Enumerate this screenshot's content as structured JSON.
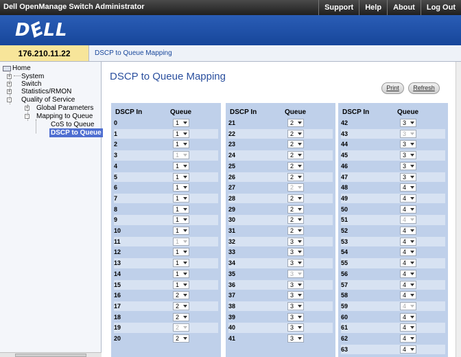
{
  "app_title": "Dell OpenManage Switch Administrator",
  "top_links": [
    "Support",
    "Help",
    "About",
    "Log Out"
  ],
  "logo": "D&LL",
  "ip": "176.210.11.22",
  "breadcrumb": "DSCP to Queue Mapping",
  "tree": [
    {
      "label": "Home",
      "icon": "home-icon"
    },
    {
      "label": "System",
      "expander": "+"
    },
    {
      "label": "Switch",
      "expander": "+"
    },
    {
      "label": "Statistics/RMON",
      "expander": "+"
    },
    {
      "label": "Quality of Service",
      "expander": "-"
    },
    {
      "label": "Global Parameters",
      "expander": "+"
    },
    {
      "label": "Mapping to Queue",
      "expander": "-"
    },
    {
      "label": "CoS to Queue"
    },
    {
      "label": "DSCP to Queue",
      "selected": true
    }
  ],
  "page_title": "DSCP to Queue Mapping",
  "buttons": {
    "print": "Print",
    "refresh": "Refresh"
  },
  "columns": {
    "dscp": "DSCP In",
    "queue": "Queue"
  },
  "tables": [
    {
      "rows": [
        {
          "dscp": "0",
          "queue": "1"
        },
        {
          "dscp": "1",
          "queue": "1"
        },
        {
          "dscp": "2",
          "queue": "1"
        },
        {
          "dscp": "3",
          "queue": "1",
          "disabled": true
        },
        {
          "dscp": "4",
          "queue": "1"
        },
        {
          "dscp": "5",
          "queue": "1"
        },
        {
          "dscp": "6",
          "queue": "1"
        },
        {
          "dscp": "7",
          "queue": "1"
        },
        {
          "dscp": "8",
          "queue": "1"
        },
        {
          "dscp": "9",
          "queue": "1"
        },
        {
          "dscp": "10",
          "queue": "1"
        },
        {
          "dscp": "11",
          "queue": "1",
          "disabled": true
        },
        {
          "dscp": "12",
          "queue": "1"
        },
        {
          "dscp": "13",
          "queue": "1"
        },
        {
          "dscp": "14",
          "queue": "1"
        },
        {
          "dscp": "15",
          "queue": "1"
        },
        {
          "dscp": "16",
          "queue": "2"
        },
        {
          "dscp": "17",
          "queue": "2"
        },
        {
          "dscp": "18",
          "queue": "2"
        },
        {
          "dscp": "19",
          "queue": "2",
          "disabled": true
        },
        {
          "dscp": "20",
          "queue": "2"
        }
      ]
    },
    {
      "rows": [
        {
          "dscp": "21",
          "queue": "2"
        },
        {
          "dscp": "22",
          "queue": "2"
        },
        {
          "dscp": "23",
          "queue": "2"
        },
        {
          "dscp": "24",
          "queue": "2"
        },
        {
          "dscp": "25",
          "queue": "2"
        },
        {
          "dscp": "26",
          "queue": "2"
        },
        {
          "dscp": "27",
          "queue": "2",
          "disabled": true
        },
        {
          "dscp": "28",
          "queue": "2"
        },
        {
          "dscp": "29",
          "queue": "2"
        },
        {
          "dscp": "30",
          "queue": "2"
        },
        {
          "dscp": "31",
          "queue": "2"
        },
        {
          "dscp": "32",
          "queue": "3"
        },
        {
          "dscp": "33",
          "queue": "3"
        },
        {
          "dscp": "34",
          "queue": "3"
        },
        {
          "dscp": "35",
          "queue": "3",
          "disabled": true
        },
        {
          "dscp": "36",
          "queue": "3"
        },
        {
          "dscp": "37",
          "queue": "3"
        },
        {
          "dscp": "38",
          "queue": "3"
        },
        {
          "dscp": "39",
          "queue": "3"
        },
        {
          "dscp": "40",
          "queue": "3"
        },
        {
          "dscp": "41",
          "queue": "3"
        }
      ]
    },
    {
      "rows": [
        {
          "dscp": "42",
          "queue": "3"
        },
        {
          "dscp": "43",
          "queue": "3",
          "disabled": true
        },
        {
          "dscp": "44",
          "queue": "3"
        },
        {
          "dscp": "45",
          "queue": "3"
        },
        {
          "dscp": "46",
          "queue": "3"
        },
        {
          "dscp": "47",
          "queue": "3"
        },
        {
          "dscp": "48",
          "queue": "4"
        },
        {
          "dscp": "49",
          "queue": "4"
        },
        {
          "dscp": "50",
          "queue": "4"
        },
        {
          "dscp": "51",
          "queue": "4",
          "disabled": true
        },
        {
          "dscp": "52",
          "queue": "4"
        },
        {
          "dscp": "53",
          "queue": "4"
        },
        {
          "dscp": "54",
          "queue": "4"
        },
        {
          "dscp": "55",
          "queue": "4"
        },
        {
          "dscp": "56",
          "queue": "4"
        },
        {
          "dscp": "57",
          "queue": "4"
        },
        {
          "dscp": "58",
          "queue": "4"
        },
        {
          "dscp": "59",
          "queue": "4",
          "disabled": true
        },
        {
          "dscp": "60",
          "queue": "4"
        },
        {
          "dscp": "61",
          "queue": "4"
        },
        {
          "dscp": "62",
          "queue": "4"
        },
        {
          "dscp": "63",
          "queue": "4"
        }
      ]
    }
  ]
}
